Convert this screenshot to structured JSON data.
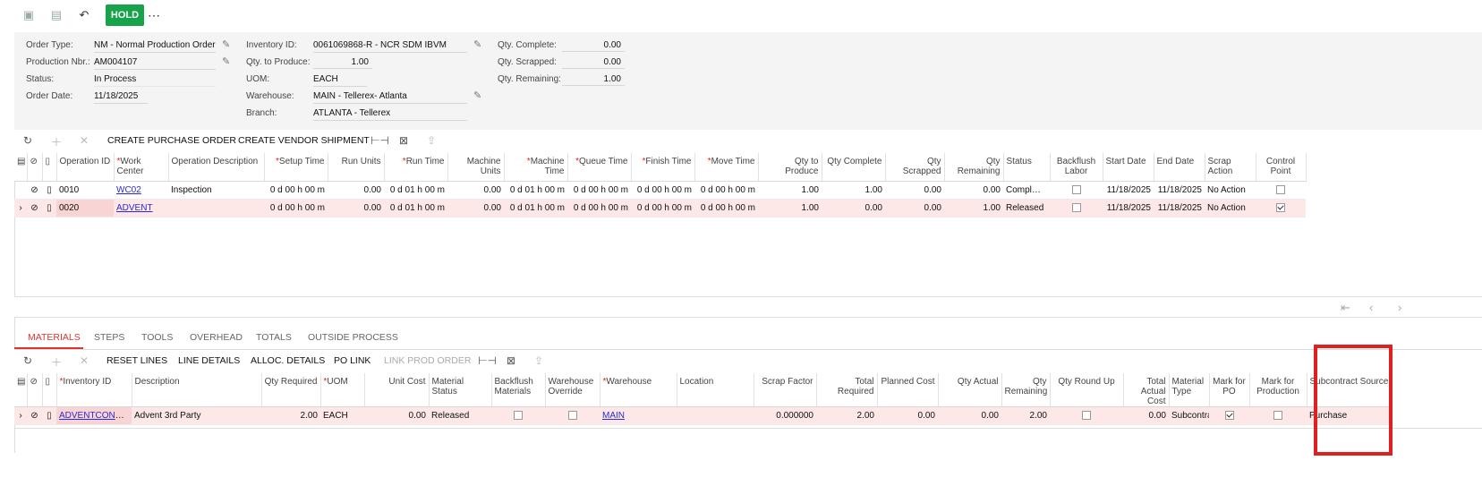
{
  "toolbar": {
    "hold_label": "HOLD",
    "more_label": "⋯"
  },
  "form": {
    "order_type": {
      "label": "Order Type:",
      "value": "NM - Normal Production Order"
    },
    "production_nbr": {
      "label": "Production Nbr.:",
      "value": "AM004107"
    },
    "status": {
      "label": "Status:",
      "value": "In Process"
    },
    "order_date": {
      "label": "Order Date:",
      "value": "11/18/2025"
    },
    "inventory_id": {
      "label": "Inventory ID:",
      "value": "0061069868-R - NCR SDM IBVM"
    },
    "qty_to_produce": {
      "label": "Qty. to Produce:",
      "value": "1.00"
    },
    "uom": {
      "label": "UOM:",
      "value": "EACH"
    },
    "warehouse": {
      "label": "Warehouse:",
      "value": "MAIN - Tellerex- Atlanta"
    },
    "branch": {
      "label": "Branch:",
      "value": "ATLANTA - Tellerex"
    },
    "qty_complete": {
      "label": "Qty. Complete:",
      "value": "0.00"
    },
    "qty_scrapped": {
      "label": "Qty. Scrapped:",
      "value": "0.00"
    },
    "qty_remaining": {
      "label": "Qty. Remaining:",
      "value": "1.00"
    }
  },
  "ops_toolbar": {
    "create_po": "CREATE PURCHASE ORDER",
    "create_vendor_shipment": "CREATE VENDOR SHIPMENT"
  },
  "ops_columns": {
    "operation_id": "Operation ID",
    "work_center": "Work Center",
    "operation_description": "Operation Description",
    "setup_time": "Setup Time",
    "run_units": "Run Units",
    "run_time": "Run Time",
    "machine_units": "Machine Units",
    "machine_time": "Machine Time",
    "queue_time": "Queue Time",
    "finish_time": "Finish Time",
    "move_time": "Move Time",
    "qty_to_produce": "Qty to Produce",
    "qty_complete": "Qty Complete",
    "qty_scrapped": "Qty Scrapped",
    "qty_remaining": "Qty Remaining",
    "status": "Status",
    "backflush_labor": "Backflush Labor",
    "start_date": "Start Date",
    "end_date": "End Date",
    "scrap_action": "Scrap Action",
    "control_point": "Control Point"
  },
  "ops_rows": [
    {
      "operation_id": "0010",
      "work_center": "WC02",
      "operation_description": "Inspection",
      "setup_time": "0 d 00 h 00 m",
      "run_units": "0.00",
      "run_time": "0 d 01 h 00 m",
      "machine_units": "0.00",
      "machine_time": "0 d 01 h 00 m",
      "queue_time": "0 d 00 h 00 m",
      "finish_time": "0 d 00 h 00 m",
      "move_time": "0 d 00 h 00 m",
      "qty_to_produce": "1.00",
      "qty_complete": "1.00",
      "qty_scrapped": "0.00",
      "qty_remaining": "0.00",
      "status": "Compl…",
      "backflush_labor": false,
      "start_date": "11/18/2025",
      "end_date": "11/18/2025",
      "scrap_action": "No Action",
      "control_point": false
    },
    {
      "operation_id": "0020",
      "work_center": "ADVENT",
      "operation_description": "",
      "setup_time": "0 d 00 h 00 m",
      "run_units": "0.00",
      "run_time": "0 d 01 h 00 m",
      "machine_units": "0.00",
      "machine_time": "0 d 01 h 00 m",
      "queue_time": "0 d 00 h 00 m",
      "finish_time": "0 d 00 h 00 m",
      "move_time": "0 d 00 h 00 m",
      "qty_to_produce": "1.00",
      "qty_complete": "0.00",
      "qty_scrapped": "0.00",
      "qty_remaining": "1.00",
      "status": "Released",
      "backflush_labor": false,
      "start_date": "11/18/2025",
      "end_date": "11/18/2025",
      "scrap_action": "No Action",
      "control_point": true
    }
  ],
  "tabs": [
    "MATERIALS",
    "STEPS",
    "TOOLS",
    "OVERHEAD",
    "TOTALS",
    "OUTSIDE PROCESS"
  ],
  "mat_toolbar": {
    "reset_lines": "RESET LINES",
    "line_details": "LINE DETAILS",
    "alloc_details": "ALLOC. DETAILS",
    "po_link": "PO LINK",
    "link_prod_order": "LINK PROD ORDER"
  },
  "mat_columns": {
    "inventory_id": "Inventory ID",
    "description": "Description",
    "qty_required": "Qty Required",
    "uom": "UOM",
    "unit_cost": "Unit Cost",
    "material_status": "Material Status",
    "backflush_materials": "Backflush Materials",
    "warehouse_override": "Warehouse Override",
    "warehouse": "Warehouse",
    "location": "Location",
    "scrap_factor": "Scrap Factor",
    "total_required": "Total Required",
    "planned_cost": "Planned Cost",
    "qty_actual": "Qty Actual",
    "qty_remaining": "Qty Remaining",
    "qty_round_up": "Qty Round Up",
    "total_actual_cost": "Total Actual Cost",
    "material_type": "Material Type",
    "mark_for_po": "Mark for PO",
    "mark_for_production": "Mark for Production",
    "subcontract_source": "Subcontract Source"
  },
  "mat_rows": [
    {
      "inventory_id": "ADVENTCONT…",
      "description": "Advent 3rd Party",
      "qty_required": "2.00",
      "uom": "EACH",
      "unit_cost": "0.00",
      "material_status": "Released",
      "backflush_materials": false,
      "warehouse_override": false,
      "warehouse": "MAIN",
      "location": "",
      "scrap_factor": "0.000000",
      "total_required": "2.00",
      "planned_cost": "0.00",
      "qty_actual": "0.00",
      "qty_remaining": "2.00",
      "qty_round_up": false,
      "total_actual_cost": "0.00",
      "material_type": "Subcontra",
      "mark_for_po": true,
      "mark_for_production": false,
      "subcontract_source": "Purchase"
    }
  ],
  "colors": {
    "accent": "#d33333",
    "hold": "#17a34a",
    "selected_row": "#fde7e7",
    "highlight": "#e02020"
  }
}
